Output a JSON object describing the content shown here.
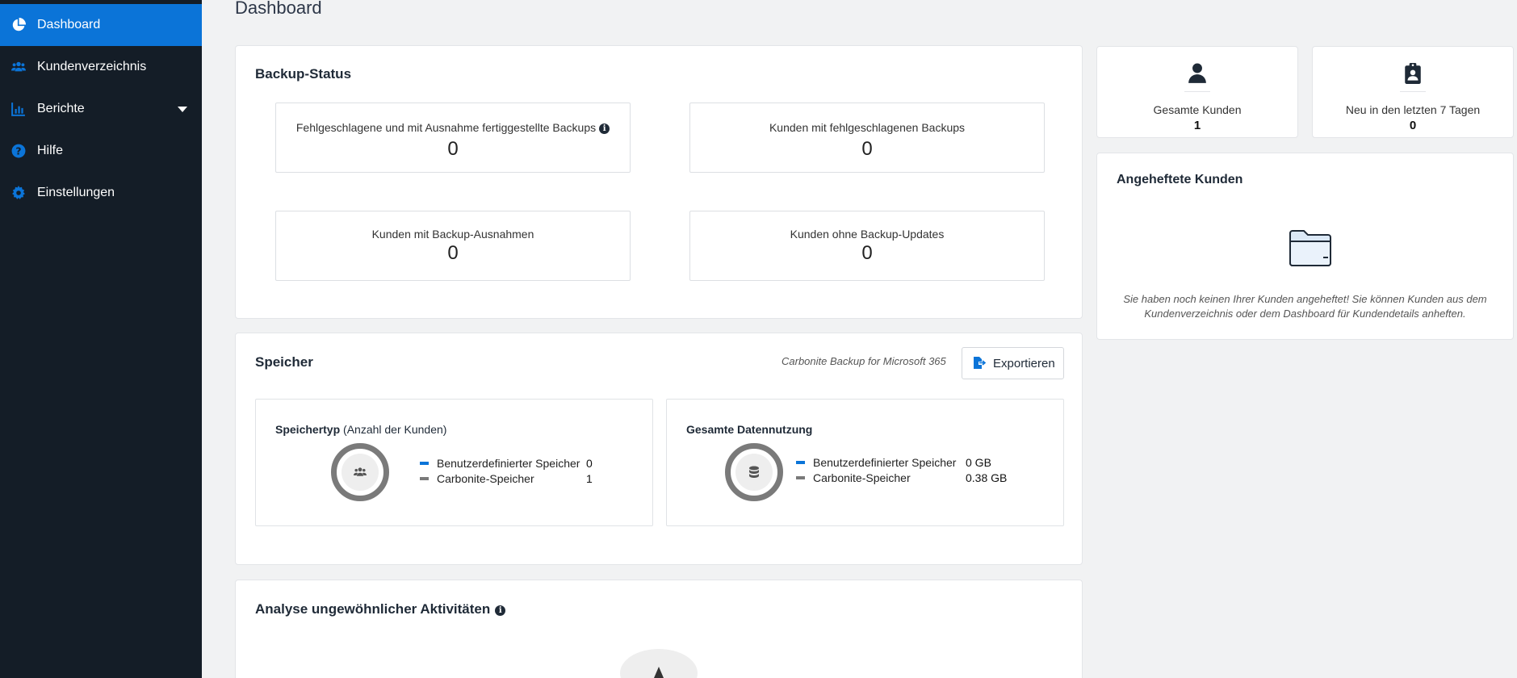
{
  "sidebar": {
    "items": [
      {
        "label": "Dashboard",
        "icon": "pie-chart-icon",
        "active": true
      },
      {
        "label": "Kundenverzeichnis",
        "icon": "users-icon"
      },
      {
        "label": "Berichte",
        "icon": "bar-chart-icon",
        "has_dropdown": true
      },
      {
        "label": "Hilfe",
        "icon": "help-circle-icon"
      },
      {
        "label": "Einstellungen",
        "icon": "gear-icon"
      }
    ]
  },
  "page": {
    "title": "Dashboard"
  },
  "backup_status": {
    "title": "Backup-Status",
    "stats": [
      {
        "label": "Fehlgeschlagene und mit Ausnahme fertiggestellte Backups",
        "value": "0",
        "has_info": true
      },
      {
        "label": "Kunden mit fehlgeschlagenen Backups",
        "value": "0"
      },
      {
        "label": "Kunden mit Backup-Ausnahmen",
        "value": "0"
      },
      {
        "label": "Kunden ohne Backup-Updates",
        "value": "0"
      }
    ]
  },
  "storage": {
    "title": "Speicher",
    "product": "Carbonite Backup for Microsoft 365",
    "export_label": "Exportieren",
    "storage_type": {
      "title": "Speichertyp",
      "subtitle": "(Anzahl der Kunden)",
      "icon": "users-icon",
      "legend": [
        {
          "label": "Benutzerdefinierter Speicher",
          "value": "0",
          "color": "#0b74d8"
        },
        {
          "label": "Carbonite-Speicher",
          "value": "1",
          "color": "#7a7a7a"
        }
      ]
    },
    "data_usage": {
      "title": "Gesamte Datennutzung",
      "icon": "database-icon",
      "legend": [
        {
          "label": "Benutzerdefinierter Speicher",
          "value": "0 GB",
          "color": "#0b74d8"
        },
        {
          "label": "Carbonite-Speicher",
          "value": "0.38 GB",
          "color": "#7a7a7a"
        }
      ]
    }
  },
  "anomaly": {
    "title": "Analyse ungewöhnlicher Aktivitäten"
  },
  "kpis": [
    {
      "label": "Gesamte Kunden",
      "value": "1",
      "icon": "user-icon"
    },
    {
      "label": "Neu in den letzten 7 Tagen",
      "value": "0",
      "icon": "clipboard-user-icon"
    }
  ],
  "pinned": {
    "title": "Angeheftete Kunden",
    "icon": "folder-icon",
    "empty_message": "Sie haben noch keinen Ihrer Kunden angeheftet! Sie können Kunden aus dem Kundenverzeichnis oder dem Dashboard für Kundendetails anheften."
  },
  "colors": {
    "accent": "#0b74d8",
    "sidebar_bg": "#141d27",
    "grey": "#7a7a7a"
  }
}
